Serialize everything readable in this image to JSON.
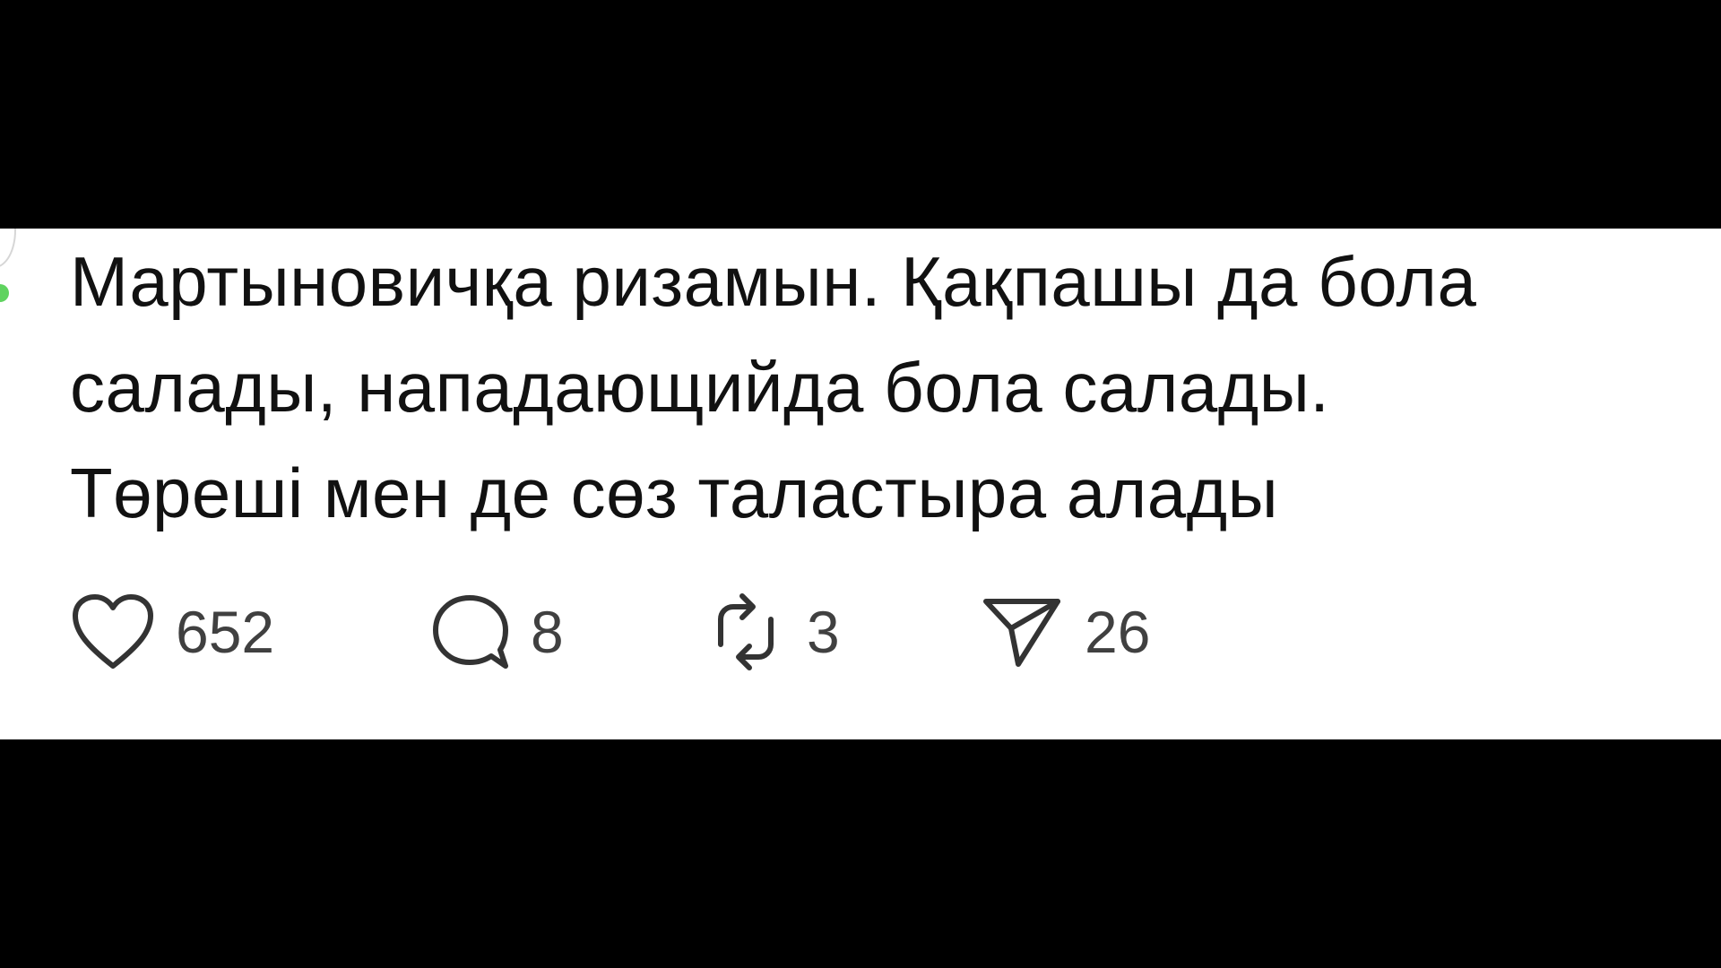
{
  "post": {
    "text_lines": [
      "Мартыновичқа ризамын. Қақпашы да бола",
      "салады, нападающийда бола салады.",
      "Төреші мен де сөз таластыра алады"
    ]
  },
  "actions": {
    "like": {
      "icon": "heart-icon",
      "count": "652"
    },
    "reply": {
      "icon": "speech-bubble-icon",
      "count": "8"
    },
    "repost": {
      "icon": "repost-arrows-icon",
      "count": "3"
    },
    "share": {
      "icon": "paper-plane-icon",
      "count": "26"
    }
  },
  "colors": {
    "background": "#000000",
    "card": "#ffffff",
    "text": "#111111",
    "icon": "#333333",
    "count": "#404040",
    "online_indicator": "#5fd35f"
  }
}
